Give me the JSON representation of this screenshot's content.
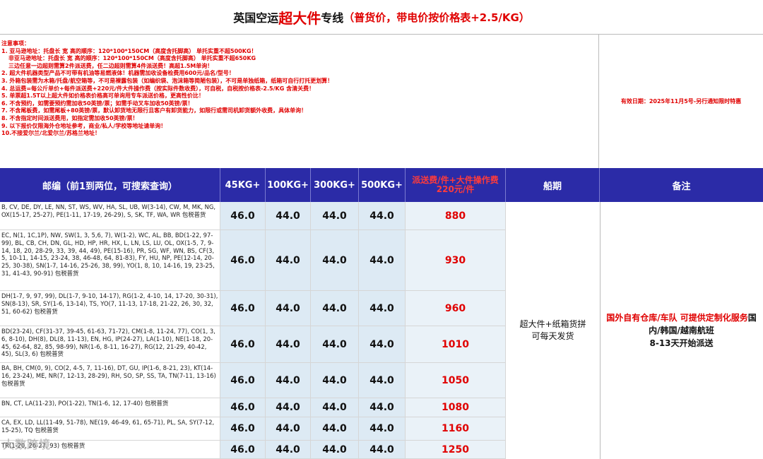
{
  "title": {
    "prefix": "英国空运",
    "highlight": "超大件",
    "suffix": "专线",
    "note": "（普货价，带电价按价格表+2.5/KG）"
  },
  "notes": {
    "heading": "注意事项：",
    "lines": [
      "1. 亚马逊地址：托盘长 宽 高的顺序：120*100*150CM（高度含托脚高）   单托实重不超500KG！",
      "非亚马逊地址：托盘长 宽 高的顺序：120*100*150CM（高度含托脚高）   单托实重不超650KG",
      "三边任意一边超则需算2件派送费，任二边超则需算4件派送费！高超1.5M单询！",
      "2. 超大件机器类型产品不可带有机油等易燃液体！机器需加收设备检费用600元/品名/型号！",
      "3. 外箱包装需为木箱/托盘/航空箱等，不可是裸露包装（如编织袋、泡沫箱等简陋包装），不可是单独纸箱，纸箱可自行打托更划算！",
      "4. 总运费=每公斤单价+每件派送费+220元/件大件操作费（按实际件数收费），可自税，自税按价格表-2.5/KG 含清关费！",
      "5. 单票超1.5T以上超大件如价格表价格高可单询用专车派送价格，更高性价比！",
      "6. 不含预约，如需要预约需加收50英镑/票；如需手动叉车加收50英镑/票！",
      "7. 不含尾板费，如需尾板+80英镑/票，默认卸货地无限行且客户有卸货能力，如限行或需司机卸货额外收费，具体单询！",
      "8. 不含指定时间派送费用，如指定需加收50英镑/票！",
      "9. 以下报价仅限海外仓地址参考，商业/私人/学校等地址请单询！",
      "10.不接爱尔兰/北爱尔兰/苏格兰地址！"
    ]
  },
  "validity": "有效日期：2025年11月5号-另行通知限时特惠",
  "headers": {
    "postcode": "邮编（前1到两位，可搜索查询）",
    "w45": "45KG+",
    "w100": "100KG+",
    "w300": "300KG+",
    "w500": "500KG+",
    "fee": "派送费/件+大件操作费220元/件",
    "ship": "船期",
    "remark": "备注"
  },
  "rows": [
    {
      "postcode": "B, CV, DE, DY, LE, NN, ST, WS, WV,   HA, SL, UB, W(3-14), CW, M, MK, NG, OX(15-17, 25-27), PE(1-11, 17-19, 26-29), S, SK, TF, WA, WR  包税普货",
      "p45": "46.0",
      "p100": "44.0",
      "p300": "44.0",
      "p500": "44.0",
      "fee": "880"
    },
    {
      "postcode": "EC, N(1, 1C,1P), NW, SW(1, 3, 5,6, 7), W(1-2), WC, AL, BB, BD(1-22, 97-99), BL, CB, CH, DN, GL, HD, HP, HR, HX, L, LN, LS, LU, OL, OX(1-5, 7, 9-14, 18, 20, 28-29, 33, 39, 44, 49), PE(15-16), PR, SG, WF, WN, BS, CF(3, 5, 10-11, 14-15, 23-24, 38, 46-48, 64, 81-83), FY, HU, NP, PE(12-14, 20-25, 30-38), SN(1-7, 14-16, 25-26, 38, 99), YO(1, 8, 10, 14-16, 19, 23-25, 31, 41-43, 90-91)  包税普货",
      "p45": "46.0",
      "p100": "44.0",
      "p300": "44.0",
      "p500": "44.0",
      "fee": "930"
    },
    {
      "postcode": "DH(1-7, 9, 97, 99), DL(1-7, 9-10, 14-17), RG(1-2, 4-10, 14, 17-20, 30-31), SN(8-13), SR, SY(1-6, 13-14), TS, YO(7, 11-13, 17-18, 21-22, 26, 30, 32, 51, 60-62)  包税普货",
      "p45": "46.0",
      "p100": "44.0",
      "p300": "44.0",
      "p500": "44.0",
      "fee": "960"
    },
    {
      "postcode": "BD(23-24), CF(31-37, 39-45, 61-63, 71-72), CM(1-8, 11-24, 77), CO(1, 3, 6, 8-10), DH(8), DL(8, 11-13), EN, HG, IP(24-27), LA(1-10), NE(1-18, 20-45, 62-64, 82, 85, 98-99), NR(1-6, 8-11, 16-27), RG(12, 21-29, 40-42, 45), SL(3, 6)  包税普货",
      "p45": "46.0",
      "p100": "44.0",
      "p300": "44.0",
      "p500": "44.0",
      "fee": "1010"
    },
    {
      "postcode": "BA, BH, CM(0, 9), CO(2, 4-5, 7, 11-16), DT, GU, IP(1-6, 8-21, 23), KT(14-16, 23-24), ME, NR(7, 12-13, 28-29), RH, SO, SP, SS, TA, TN(7-11, 13-16) 包税普货",
      "p45": "46.0",
      "p100": "44.0",
      "p300": "44.0",
      "p500": "44.0",
      "fee": "1050"
    },
    {
      "postcode": "BN, CT, LA(11-23), PO(1-22), TN(1-6, 12, 17-40)  包税普货",
      "p45": "46.0",
      "p100": "44.0",
      "p300": "44.0",
      "p500": "44.0",
      "fee": "1080"
    },
    {
      "postcode": "CA, EX, LD, LL(11-49, 51-78), NE(19, 46-49, 61, 65-71), PL, SA, SY(7-12, 15-25), TQ  包税普货",
      "p45": "46.0",
      "p100": "44.0",
      "p300": "44.0",
      "p500": "44.0",
      "fee": "1160"
    },
    {
      "postcode": "TR(1-20, 26-27, 93)  包税普货",
      "p45": "46.0",
      "p100": "44.0",
      "p300": "44.0",
      "p500": "44.0",
      "fee": "1250"
    }
  ],
  "ship": {
    "line1": "超大件+纸箱货拼",
    "line2": "可每天发货"
  },
  "remark": {
    "red": "国外自有仓库/车队 可提供定制化服务",
    "black1": "国内/韩国/越南航班",
    "black2": "8-13天开始派送"
  },
  "watermark": "大数跨境",
  "colors": {
    "accent_red": "#e00000",
    "header_blue": "#2b2ba7",
    "price_bg": "#ddeaf4"
  }
}
